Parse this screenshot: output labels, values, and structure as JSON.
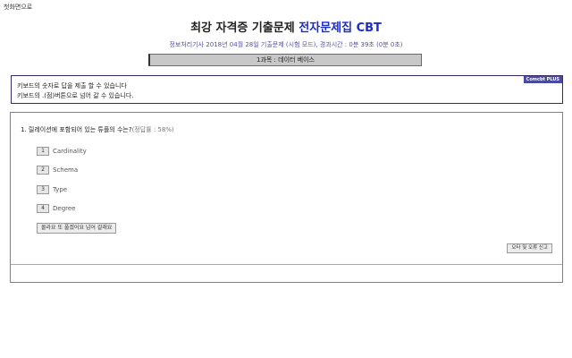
{
  "header": {
    "home_link": "첫화면으로",
    "title_main": "최강 자격증 기출문제 ",
    "title_accent": "전자문제집 CBT",
    "subtitle": "정보처리기사 2018년 04월 28일 기출문제 (시험 모드), 경과시간 : 0분 39초 (0분 0초)"
  },
  "section": {
    "label": "1과목 : 데이터 베이스"
  },
  "info_box": {
    "line1": "키보드의 숫자로 답을 제출 할 수 있습니다",
    "line2": "키보드의 .(점)버튼으로 넘어 갈 수 있습니다.",
    "badge": "Comcbt PLUS"
  },
  "question": {
    "text": "1. 릴레이션에 포함되어 있는 튜플의 수는?",
    "rate": "(정답률 : 58%)",
    "options": [
      {
        "num": "1",
        "label": "Cardinality"
      },
      {
        "num": "2",
        "label": "Schema"
      },
      {
        "num": "3",
        "label": "Type"
      },
      {
        "num": "4",
        "label": "Degree"
      }
    ],
    "skip_label": "몰라요 또 풀겠어요 넘어 갈래요",
    "report_label": "오타 및 오류 신고"
  },
  "colors": {
    "accent": "#1a2bd0",
    "panel_border": "#4a90c8",
    "info_border": "#3a2a6a"
  }
}
